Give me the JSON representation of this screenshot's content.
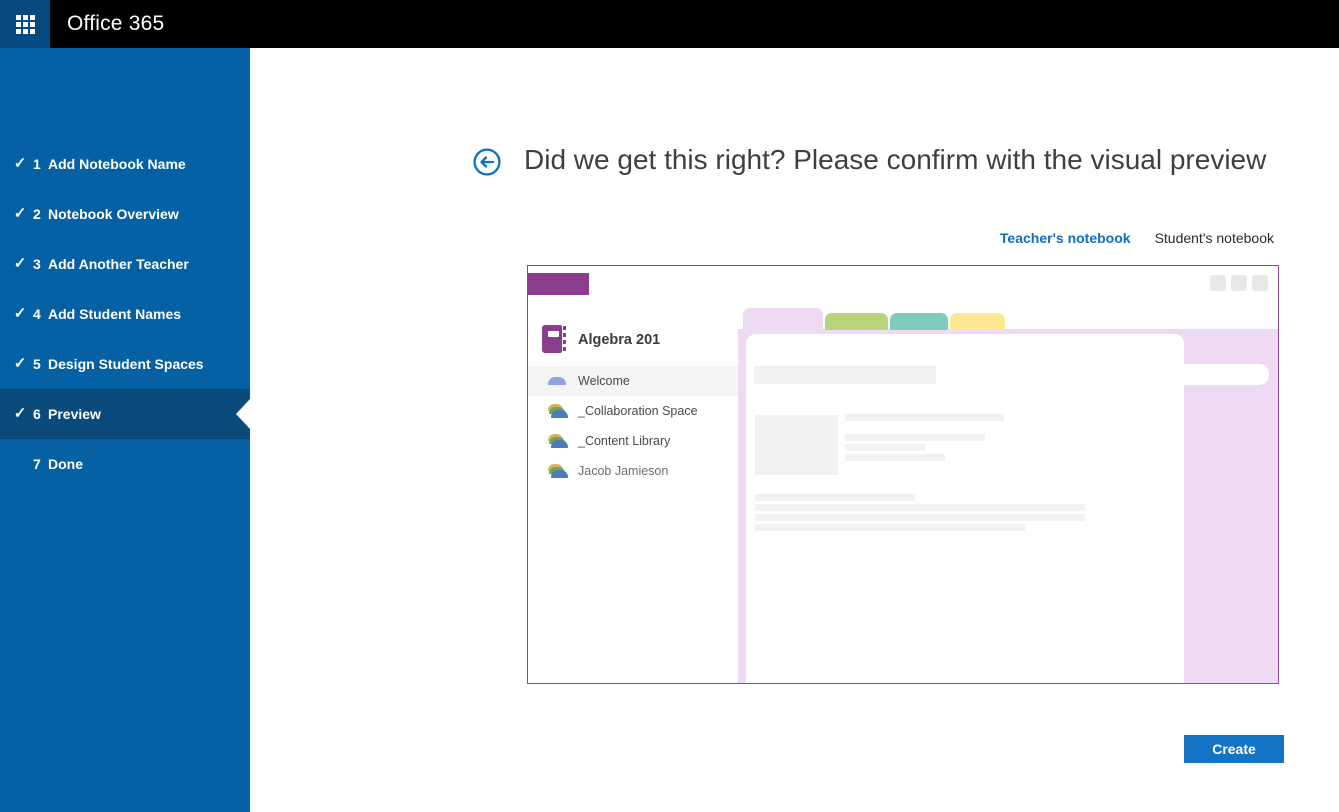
{
  "app": {
    "title": "Office 365"
  },
  "colors": {
    "topbar_bg": "#000000",
    "app_tile_bg": "#04497f",
    "sidebar_bg": "#0561a4",
    "sidebar_active_bg": "#0b4b7b",
    "accent_blue": "#0e6fc1",
    "create_button_bg": "#1373c4",
    "preview_border": "#8a4b8d",
    "notebook_purple": "#8d3d8d",
    "preview_pink": "#eedaf2",
    "tab_green": "#b5d47c",
    "tab_teal": "#7fccbd",
    "tab_yellow": "#fbe88f",
    "placeholder_gray": "#f1f1f1"
  },
  "sidebar": {
    "steps": [
      {
        "num": "1",
        "label": "Add Notebook Name",
        "check": "✓"
      },
      {
        "num": "2",
        "label": "Notebook Overview",
        "check": "✓"
      },
      {
        "num": "3",
        "label": "Add Another Teacher",
        "check": "✓"
      },
      {
        "num": "4",
        "label": "Add Student Names",
        "check": "✓"
      },
      {
        "num": "5",
        "label": "Design Student Spaces",
        "check": "✓"
      },
      {
        "num": "6",
        "label": "Preview",
        "check": "✓"
      },
      {
        "num": "7",
        "label": "Done",
        "check": ""
      }
    ]
  },
  "main": {
    "heading": "Did we get this right? Please confirm with the visual preview",
    "tabs": [
      {
        "label": "Teacher's notebook"
      },
      {
        "label": "Student's notebook"
      }
    ],
    "create_label": "Create"
  },
  "preview": {
    "notebook_title": "Algebra 201",
    "sections": [
      {
        "label": "Welcome"
      },
      {
        "label": "_Collaboration Space"
      },
      {
        "label": "_Content Library"
      },
      {
        "label": "Jacob Jamieson"
      }
    ]
  }
}
